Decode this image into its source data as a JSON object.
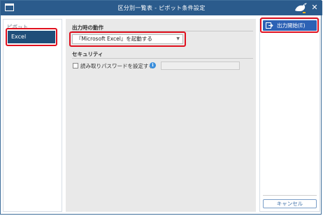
{
  "window": {
    "title": "区分別一覧表 - ピボット条件設定"
  },
  "sidebar": {
    "header": "ピボット",
    "items": [
      {
        "label": "Excel",
        "selected": true
      }
    ]
  },
  "output_section": {
    "header": "出力時の動作",
    "select": {
      "value": "『Microsoft Excel』を起動する"
    }
  },
  "security_section": {
    "header": "セキュリティ",
    "checkbox": {
      "label": "読み取りパスワードを設定する",
      "checked": false
    },
    "info_icon": "i",
    "password": {
      "value": ""
    }
  },
  "actions": {
    "export_label": "出力開始(E)",
    "cancel_label": "キャンセル"
  },
  "colors": {
    "titlebar": "#2b5b8c",
    "selected_nav": "#1f4e79",
    "primary_button": "#2d62b5",
    "highlight": "#e0101e"
  }
}
